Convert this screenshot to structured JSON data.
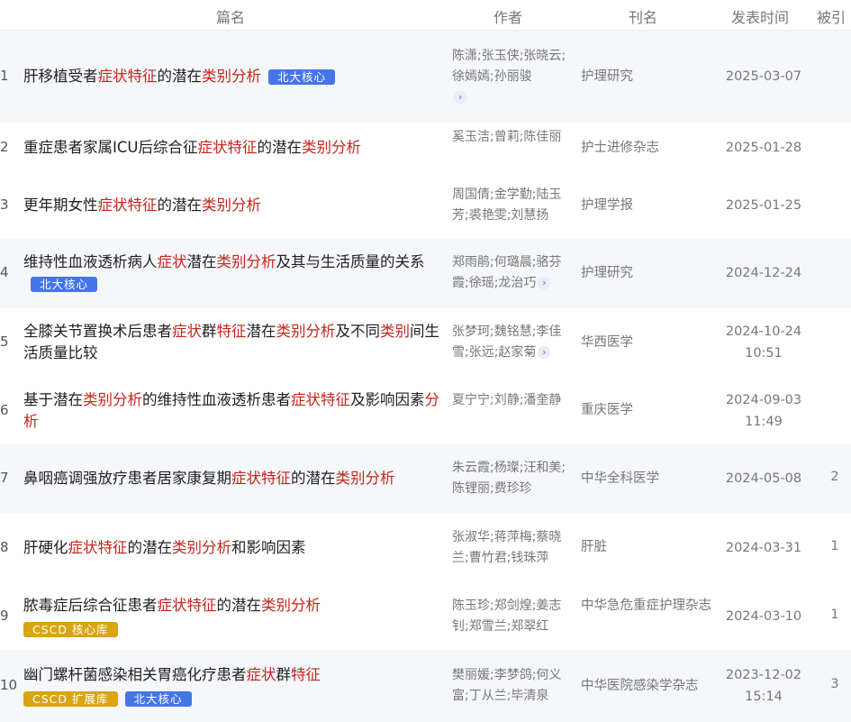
{
  "header": {
    "title": "篇名",
    "author": "作者",
    "journal": "刊名",
    "date": "发表时间",
    "cite": "被引"
  },
  "colors": {
    "highlight": "#c3251c",
    "badge_blue": "#4576e6",
    "badge_gold": "#d9a514",
    "alt_row": "#f5f7fa"
  },
  "rows": [
    {
      "num": "1",
      "title": [
        {
          "t": "肝移植受者"
        },
        {
          "t": "症状特征",
          "h": true
        },
        {
          "t": "的潜在"
        },
        {
          "t": "类别分析",
          "h": true
        }
      ],
      "badges": [
        {
          "label": "北大核心",
          "color": "blue"
        }
      ],
      "authors": "陈潇;张玉侠;张晓云;徐嫣嫣;孙丽骏",
      "more": true,
      "journal": "护理研究",
      "date": "2025-03-07",
      "time": "",
      "cite": ""
    },
    {
      "num": "2",
      "title": [
        {
          "t": "重症患者家属ICU后综合征"
        },
        {
          "t": "症状特征",
          "h": true
        },
        {
          "t": "的潜在"
        },
        {
          "t": "类别分析",
          "h": true
        }
      ],
      "badges": [],
      "authors": "奚玉洁;曾莉;陈佳丽",
      "more": false,
      "journal": "护士进修杂志",
      "date": "2025-01-28",
      "time": "",
      "cite": ""
    },
    {
      "num": "3",
      "title": [
        {
          "t": "更年期女性"
        },
        {
          "t": "症状特征",
          "h": true
        },
        {
          "t": "的潜在"
        },
        {
          "t": "类别分析",
          "h": true
        }
      ],
      "badges": [],
      "authors": "周国倩;金学勤;陆玉芳;裘艳雯;刘慧扬",
      "more": false,
      "journal": "护理学报",
      "date": "2025-01-25",
      "time": "",
      "cite": ""
    },
    {
      "num": "4",
      "title": [
        {
          "t": "维持性血液透析病人"
        },
        {
          "t": "症状",
          "h": true
        },
        {
          "t": "潜在"
        },
        {
          "t": "类别分析",
          "h": true
        },
        {
          "t": "及其与生活质量的关系"
        }
      ],
      "badges": [
        {
          "label": "北大核心",
          "color": "blue"
        }
      ],
      "authors": "郑雨鹃;何璐晨;骆芬霞;徐瑶;龙治巧",
      "more": true,
      "journal": "护理研究",
      "date": "2024-12-24",
      "time": "",
      "cite": ""
    },
    {
      "num": "5",
      "title": [
        {
          "t": "全膝关节置换术后患者"
        },
        {
          "t": "症状",
          "h": true
        },
        {
          "t": "群"
        },
        {
          "t": "特征",
          "h": true
        },
        {
          "t": "潜在"
        },
        {
          "t": "类别分析",
          "h": true
        },
        {
          "t": "及不同"
        },
        {
          "t": "类别",
          "h": true
        },
        {
          "t": "间生活质量比较"
        }
      ],
      "badges": [],
      "authors": "张梦珂;魏铭慧;李佳雪;张远;赵家菊",
      "more": true,
      "journal": "华西医学",
      "date": "2024-10-24",
      "time": "10:51",
      "cite": ""
    },
    {
      "num": "6",
      "title": [
        {
          "t": "基于潜在"
        },
        {
          "t": "类别分析",
          "h": true
        },
        {
          "t": "的维持性血液透析患者"
        },
        {
          "t": "症状特征",
          "h": true
        },
        {
          "t": "及影响因素"
        },
        {
          "t": "分析",
          "h": true
        }
      ],
      "badges": [],
      "authors": "夏宁宁;刘静;潘奎静",
      "more": false,
      "journal": "重庆医学",
      "date": "2024-09-03",
      "time": "11:49",
      "cite": ""
    },
    {
      "num": "7",
      "title": [
        {
          "t": "鼻咽癌调强放疗患者居家康复期"
        },
        {
          "t": "症状特征",
          "h": true
        },
        {
          "t": "的潜在"
        },
        {
          "t": "类别分析",
          "h": true
        }
      ],
      "badges": [],
      "authors": "朱云霞;杨璨;汪和美;陈锂丽;费珍珍",
      "more": false,
      "journal": "中华全科医学",
      "date": "2024-05-08",
      "time": "",
      "cite": "2"
    },
    {
      "num": "8",
      "title": [
        {
          "t": "肝硬化"
        },
        {
          "t": "症状特征",
          "h": true
        },
        {
          "t": "的潜在"
        },
        {
          "t": "类别分析",
          "h": true
        },
        {
          "t": "和影响因素"
        }
      ],
      "badges": [],
      "authors": "张淑华;蒋萍梅;蔡晓兰;曹竹君;钱珠萍",
      "more": false,
      "journal": "肝脏",
      "date": "2024-03-31",
      "time": "",
      "cite": "1"
    },
    {
      "num": "9",
      "title": [
        {
          "t": "脓毒症后综合征患者"
        },
        {
          "t": "症状特征",
          "h": true
        },
        {
          "t": "的潜在"
        },
        {
          "t": "类别分析",
          "h": true
        }
      ],
      "badges": [
        {
          "label": "CSCD 核心库",
          "color": "gold"
        }
      ],
      "authors": "陈玉珍;郑剑煌;姜志钊;郑雪兰;郑翠红",
      "more": false,
      "journal": "中华急危重症护理杂志",
      "date": "2024-03-10",
      "time": "",
      "cite": "1"
    },
    {
      "num": "10",
      "title": [
        {
          "t": "幽门螺杆菌感染相关胃癌化疗患者"
        },
        {
          "t": "症状",
          "h": true
        },
        {
          "t": "群"
        },
        {
          "t": "特征",
          "h": true
        }
      ],
      "badges": [
        {
          "label": "CSCD 扩展库",
          "color": "gold"
        },
        {
          "label": "北大核心",
          "color": "blue"
        }
      ],
      "authors": "樊丽媛;李梦鸽;何义富;丁从兰;毕清泉",
      "more": false,
      "journal": "中华医院感染学杂志",
      "date": "2023-12-02",
      "time": "15:14",
      "cite": "3"
    }
  ]
}
